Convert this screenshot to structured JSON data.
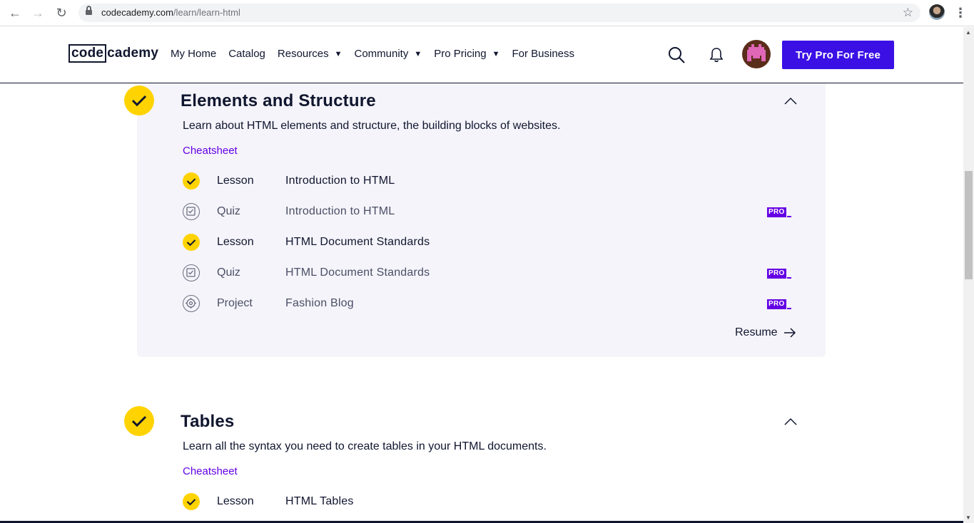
{
  "browser": {
    "url_host": "codecademy.com",
    "url_path": "/learn/learn-html"
  },
  "header": {
    "logo_boxed": "code",
    "logo_rest": "cademy",
    "nav": [
      {
        "label": "My Home",
        "dropdown": false
      },
      {
        "label": "Catalog",
        "dropdown": false
      },
      {
        "label": "Resources",
        "dropdown": true
      },
      {
        "label": "Community",
        "dropdown": true
      },
      {
        "label": "Pro Pricing",
        "dropdown": true
      },
      {
        "label": "For Business",
        "dropdown": false
      }
    ],
    "cta_label": "Try Pro For Free"
  },
  "modules": [
    {
      "title": "Elements and Structure",
      "description": "Learn about HTML elements and structure, the building blocks of websites.",
      "cheatsheet_label": "Cheatsheet",
      "completed": true,
      "expanded": true,
      "items": [
        {
          "type": "Lesson",
          "name": "Introduction to HTML",
          "completed": true,
          "pro": false,
          "icon": "check-icon"
        },
        {
          "type": "Quiz",
          "name": "Introduction to HTML",
          "completed": false,
          "pro": true,
          "icon": "quiz-icon"
        },
        {
          "type": "Lesson",
          "name": "HTML Document Standards",
          "completed": true,
          "pro": false,
          "icon": "check-icon"
        },
        {
          "type": "Quiz",
          "name": "HTML Document Standards",
          "completed": false,
          "pro": true,
          "icon": "quiz-icon"
        },
        {
          "type": "Project",
          "name": "Fashion Blog",
          "completed": false,
          "pro": true,
          "icon": "project-icon"
        }
      ],
      "resume_label": "Resume"
    },
    {
      "title": "Tables",
      "description": "Learn all the syntax you need to create tables in your HTML documents.",
      "cheatsheet_label": "Cheatsheet",
      "completed": true,
      "expanded": true,
      "items": [
        {
          "type": "Lesson",
          "name": "HTML Tables",
          "completed": true,
          "pro": false,
          "icon": "check-icon"
        }
      ]
    }
  ],
  "pro_badge_label": "PRO",
  "colors": {
    "accent": "#3a10e5",
    "yellow": "#ffd300",
    "purple": "#6400e4",
    "navy": "#10162f",
    "panel": "#f5f4fa"
  }
}
